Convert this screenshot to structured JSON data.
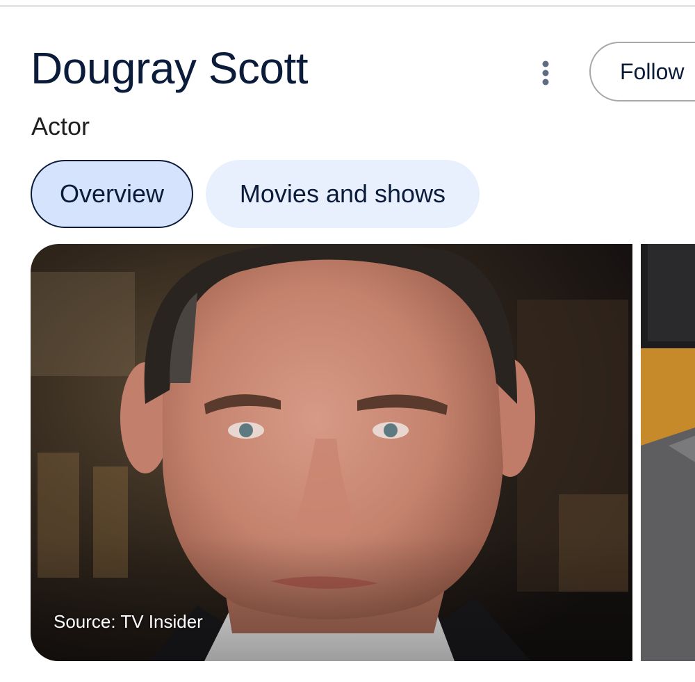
{
  "header": {
    "title": "Dougray Scott",
    "subtitle": "Actor",
    "more_icon": "more-vert-icon",
    "follow_label": "Follow"
  },
  "tabs": [
    {
      "label": "Overview",
      "selected": true
    },
    {
      "label": "Movies and shows",
      "selected": false
    }
  ],
  "images": [
    {
      "source": "Source: TV Insider"
    }
  ],
  "colors": {
    "title": "#0b1b3a",
    "tab_selected_bg": "#d6e3fc",
    "tab_bg": "#e8effd",
    "icon": "#5f6b85"
  }
}
